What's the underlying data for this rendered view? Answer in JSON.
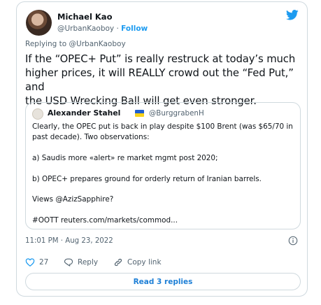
{
  "author": {
    "name": "Michael Kao",
    "handle": "@UrbanKaoboy",
    "separator": "·",
    "follow_label": "Follow"
  },
  "replying_to": "Replying to @UrbanKaoboy",
  "tweet_lines": [
    "If the “OPEC+ Put” is really restruck at today’s much",
    "higher prices, it will REALLY crowd out the “Fed Put,” and",
    "the USD Wrecking Ball will get even stronger."
  ],
  "quote": {
    "name": "Alexander Stahel",
    "flag": "Ukraine flag",
    "handle": "@BurggrabenH",
    "lines": [
      "Clearly, the OPEC put is back in play despite $100 Brent (was $65/70 in",
      "past decade). Two observations:",
      "",
      "a) Saudis more «alert» re market mgmt post 2020;",
      "",
      "b) OPEC+ prepares ground for orderly return of Iranian barrels.",
      "",
      "Views @AzizSapphire?",
      "",
      "#OOTT reuters.com/markets/commod..."
    ]
  },
  "timestamp": "11:01 PM · Aug 23, 2022",
  "actions": {
    "like_count": "27",
    "reply_label": "Reply",
    "copy_link_label": "Copy link"
  },
  "read_replies_label": "Read 3 replies",
  "colors": {
    "accent": "#1d9bf0",
    "like_icon": "#1d9bf0",
    "muted_text": "#536471",
    "border": "#cfd9de"
  },
  "icons": {
    "brand": "twitter-bird-icon",
    "info": "info-icon",
    "like": "heart-icon",
    "reply": "reply-bubble-icon",
    "copy": "link-icon"
  }
}
